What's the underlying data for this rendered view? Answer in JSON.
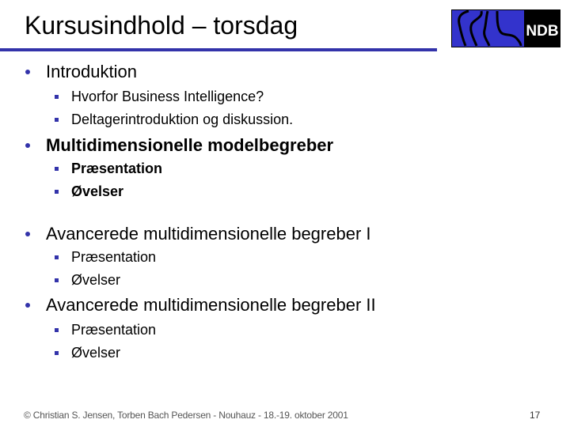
{
  "slide": {
    "title": "Kursusindhold – torsdag",
    "logo": {
      "text": "NDB",
      "icon": "ndb-logo-icon",
      "colors": {
        "blue": "#3333cc",
        "black": "#000000"
      }
    },
    "accent_color": "#3333aa",
    "sections": [
      {
        "label": "Introduktion",
        "bold": false,
        "items": [
          "Hvorfor Business Intelligence?",
          "Deltagerintroduktion og diskussion."
        ]
      },
      {
        "label": "Multidimensionelle modelbegreber",
        "bold": true,
        "items": [
          "Præsentation",
          "Øvelser"
        ]
      },
      {
        "label": "Avancerede multidimensionelle begreber I",
        "bold": false,
        "items": [
          "Præsentation",
          "Øvelser"
        ]
      },
      {
        "label": "Avancerede multidimensionelle begreber II",
        "bold": false,
        "items": [
          "Præsentation",
          "Øvelser"
        ]
      }
    ],
    "footer": "© Christian S. Jensen, Torben Bach Pedersen - Nouhauz - 18.-19. oktober 2001",
    "page_number": "17"
  }
}
